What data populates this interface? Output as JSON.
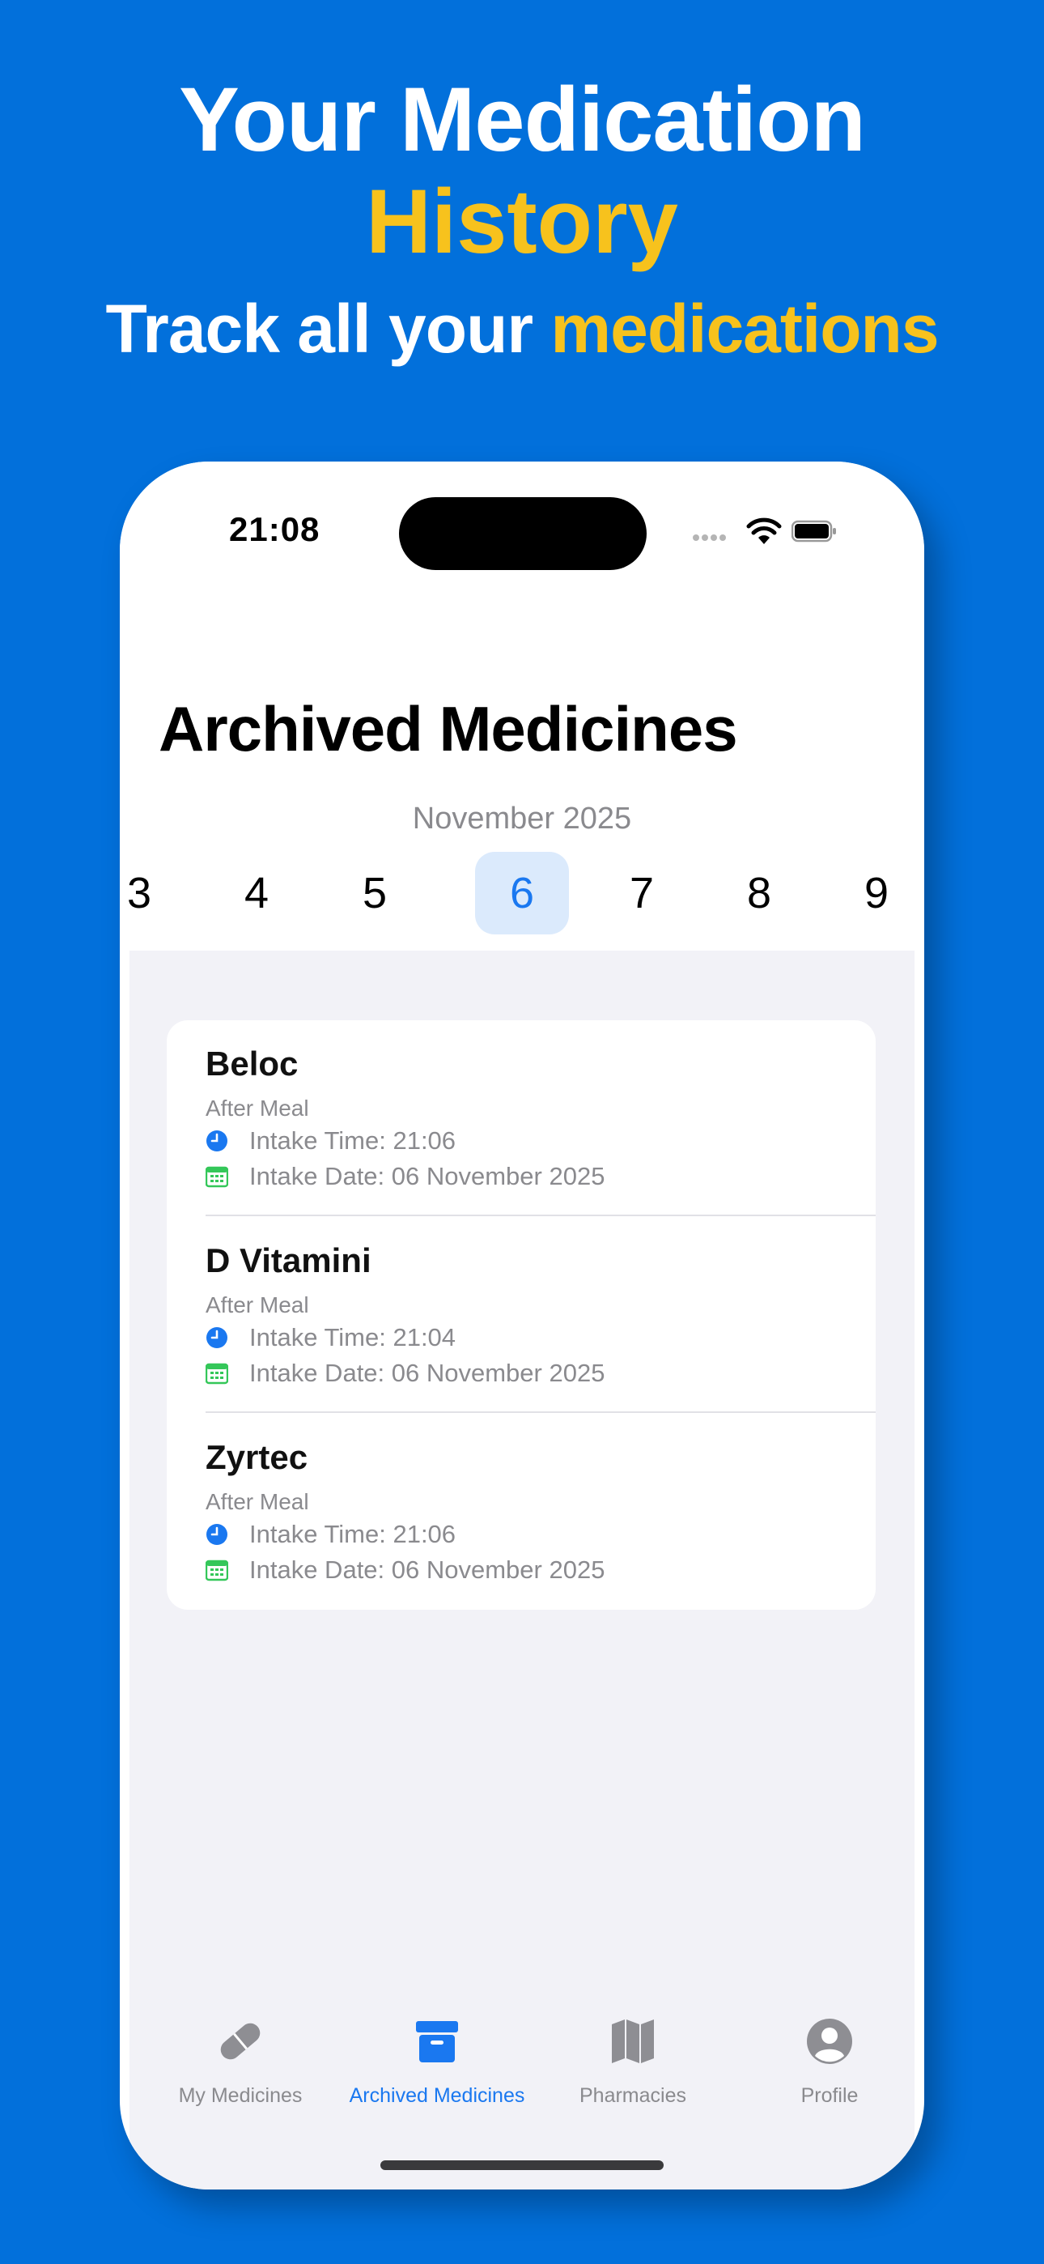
{
  "promo": {
    "line1": "Your Medication",
    "line2": "History",
    "line3_prefix": "Track all your ",
    "line3_accent": "medications",
    "colors": {
      "background": "#0270db",
      "accent": "#f7c21d",
      "text": "#ffffff"
    }
  },
  "status_bar": {
    "time": "21:08",
    "icons": [
      "signal-dots-icon",
      "wifi-icon",
      "battery-icon"
    ]
  },
  "screen": {
    "title": "Archived Medicines",
    "month": "November 2025",
    "days": [
      "3",
      "4",
      "5",
      "6",
      "7",
      "8",
      "9"
    ],
    "selected_day": "6"
  },
  "medicines": [
    {
      "name": "Beloc",
      "meal": "After Meal",
      "time": "Intake Time: 21:06",
      "date": "Intake Date: 06 November 2025"
    },
    {
      "name": "D Vitamini",
      "meal": "After Meal",
      "time": "Intake Time: 21:04",
      "date": "Intake Date: 06 November 2025"
    },
    {
      "name": "Zyrtec",
      "meal": "After Meal",
      "time": "Intake Time: 21:06",
      "date": "Intake Date: 06 November 2025"
    }
  ],
  "tabs": [
    {
      "label": "My Medicines",
      "icon": "pill-icon",
      "active": false
    },
    {
      "label": "Archived Medicines",
      "icon": "archive-box-icon",
      "active": true
    },
    {
      "label": "Pharmacies",
      "icon": "map-icon",
      "active": false
    },
    {
      "label": "Profile",
      "icon": "person-circle-icon",
      "active": false
    }
  ],
  "theme": {
    "tint": "#1a78f0",
    "clock_icon": "#1a78f0",
    "calendar_icon": "#34c759"
  }
}
